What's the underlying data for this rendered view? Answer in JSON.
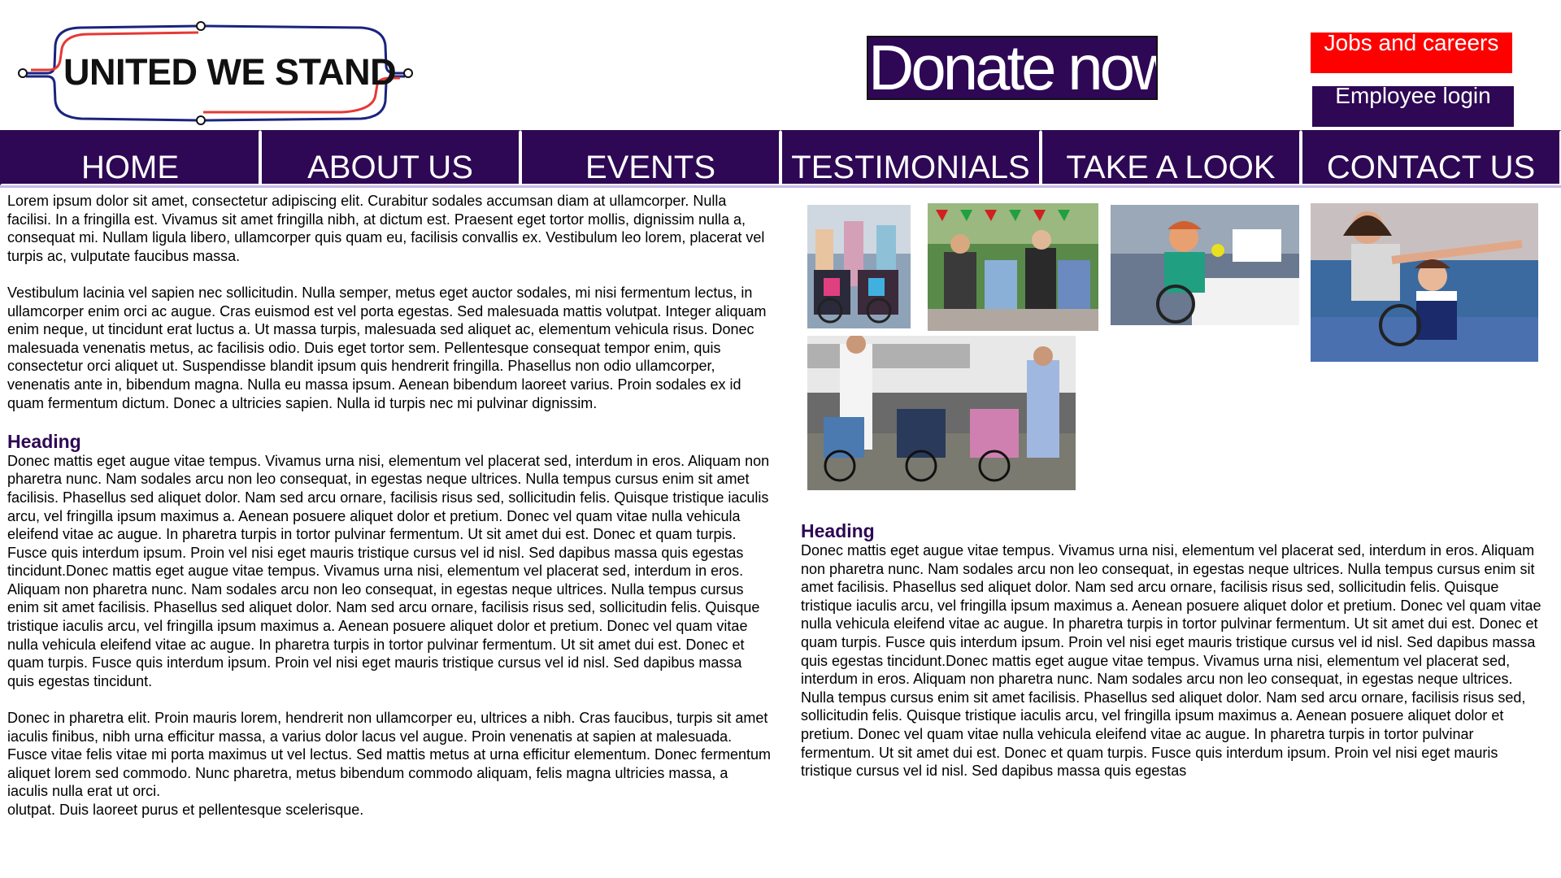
{
  "header": {
    "logo_text": "UNITED WE STAND",
    "donate_label": "Donate now!",
    "jobs_label": "Jobs and careers",
    "login_label": "Employee login"
  },
  "nav": {
    "items": [
      "HOME",
      "ABOUT US",
      "EVENTS",
      "TESTIMONIALS",
      "TAKE A LOOK",
      "CONTACT US"
    ]
  },
  "left": {
    "para1": "Lorem ipsum dolor sit amet, consectetur adipiscing elit. Curabitur sodales accumsan diam at ullamcorper. Nulla facilisi. In a fringilla est. Vivamus sit amet fringilla nibh, at dictum est. Praesent eget tortor mollis, dignissim nulla a, consequat mi. Nullam ligula libero, ullamcorper quis quam eu, facilisis convallis ex. Vestibulum leo lorem, placerat vel turpis ac, vulputate faucibus massa.",
    "para2": "Vestibulum lacinia vel sapien nec sollicitudin. Nulla semper, metus eget auctor sodales, mi nisi fermentum lectus, in ullamcorper enim orci ac augue. Cras euismod est vel porta egestas. Sed malesuada mattis volutpat. Integer aliquam enim neque, ut tincidunt erat luctus a. Ut massa turpis, malesuada sed aliquet ac, elementum vehicula risus. Donec malesuada venenatis metus, ac facilisis odio. Duis eget tortor sem. Pellentesque consequat tempor enim, quis consectetur orci aliquet ut. Suspendisse blandit ipsum quis hendrerit fringilla. Phasellus non odio ullamcorper, venenatis ante in, bibendum magna. Nulla eu massa ipsum. Aenean bibendum laoreet varius. Proin sodales ex id quam fermentum dictum. Donec a ultricies sapien. Nulla id turpis nec mi pulvinar dignissim.",
    "heading": "Heading",
    "para3": "Donec mattis eget augue vitae tempus. Vivamus urna nisi, elementum vel placerat sed, interdum in eros. Aliquam non pharetra nunc. Nam sodales arcu non leo consequat, in egestas neque ultrices. Nulla tempus cursus enim sit amet facilisis. Phasellus sed aliquet dolor. Nam sed arcu ornare, facilisis risus sed, sollicitudin felis. Quisque tristique iaculis arcu, vel fringilla ipsum maximus a. Aenean posuere aliquet dolor et pretium. Donec vel quam vitae nulla vehicula eleifend vitae ac augue. In pharetra turpis in tortor pulvinar fermentum. Ut sit amet dui est. Donec et quam turpis. Fusce quis interdum ipsum. Proin vel nisi eget mauris tristique cursus vel id nisl. Sed dapibus massa quis egestas tincidunt.Donec mattis eget augue vitae tempus. Vivamus urna nisi, elementum vel placerat sed, interdum in eros. Aliquam non pharetra nunc. Nam sodales arcu non leo consequat, in egestas neque ultrices. Nulla tempus cursus enim sit amet facilisis. Phasellus sed aliquet dolor. Nam sed arcu ornare, facilisis risus sed, sollicitudin felis. Quisque tristique iaculis arcu, vel fringilla ipsum maximus a. Aenean posuere aliquet dolor et pretium. Donec vel quam vitae nulla vehicula eleifend vitae ac augue. In pharetra turpis in tortor pulvinar fermentum. Ut sit amet dui est. Donec et quam turpis. Fusce quis interdum ipsum. Proin vel nisi eget mauris tristique cursus vel id nisl. Sed dapibus massa quis egestas tincidunt.",
    "para4": "Donec in pharetra elit. Proin mauris lorem, hendrerit non ullamcorper eu, ultrices a nibh. Cras faucibus, turpis sit amet iaculis finibus, nibh urna efficitur massa, a varius dolor lacus vel augue. Proin venenatis at sapien at malesuada. Fusce vitae felis vitae mi porta maximus ut vel lectus. Sed mattis metus at urna efficitur elementum. Donec fermentum aliquet lorem sed commodo. Nunc pharetra, metus bibendum commodo aliquam, felis magna ultricies massa, a iaculis nulla erat ut orci.",
    "para5": "olutpat. Duis laoreet purus et pellentesque scelerisque."
  },
  "right": {
    "heading": "Heading",
    "para": "Donec mattis eget augue vitae tempus. Vivamus urna nisi, elementum vel placerat sed, interdum in eros. Aliquam non pharetra nunc. Nam sodales arcu non leo consequat, in egestas neque ultrices. Nulla tempus cursus enim sit amet facilisis. Phasellus sed aliquet dolor. Nam sed arcu ornare, facilisis risus sed, sollicitudin felis. Quisque tristique iaculis arcu, vel fringilla ipsum maximus a. Aenean posuere aliquet dolor et pretium. Donec vel quam vitae nulla vehicula eleifend vitae ac augue. In pharetra turpis in tortor pulvinar fermentum. Ut sit amet dui est. Donec et quam turpis. Fusce quis interdum ipsum. Proin vel nisi eget mauris tristique cursus vel id nisl. Sed dapibus massa quis egestas tincidunt.Donec mattis eget augue vitae tempus. Vivamus urna nisi, elementum vel placerat sed, interdum in eros. Aliquam non pharetra nunc. Nam sodales arcu non leo consequat, in egestas neque ultrices. Nulla tempus cursus enim sit amet facilisis. Phasellus sed aliquet dolor. Nam sed arcu ornare, facilisis risus sed, sollicitudin felis. Quisque tristique iaculis arcu, vel fringilla ipsum maximus a. Aenean posuere aliquet dolor et pretium. Donec vel quam vitae nulla vehicula eleifend vitae ac augue. In pharetra turpis in tortor pulvinar fermentum. Ut sit amet dui est. Donec et quam turpis. Fusce quis interdum ipsum. Proin vel nisi eget mauris tristique cursus vel id nisl. Sed dapibus massa quis egestas"
  },
  "colors": {
    "brand_purple": "#2e0854",
    "accent_red": "#ff0000",
    "logo_blue": "#1a237e",
    "logo_red": "#e53935"
  }
}
